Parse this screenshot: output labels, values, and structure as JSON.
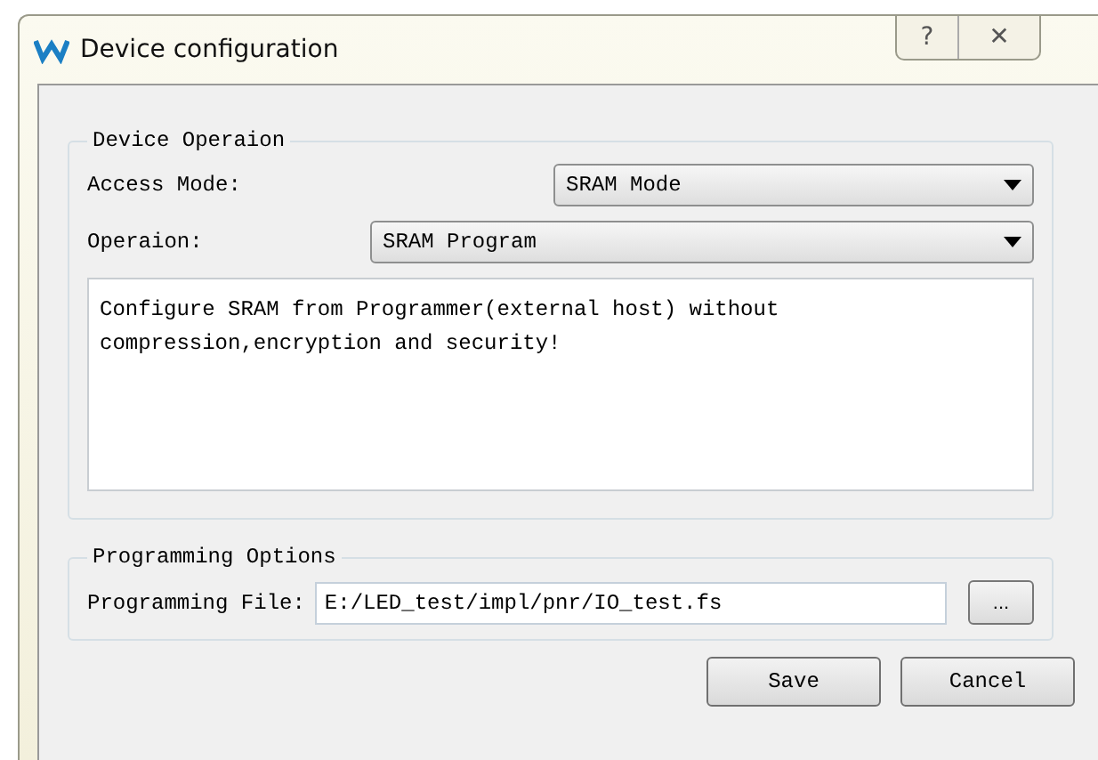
{
  "window": {
    "title": "Device configuration",
    "help": "?",
    "close": "✕"
  },
  "device_operation": {
    "title": "Device Operaion",
    "access_mode": {
      "label": "Access Mode:",
      "value": "SRAM Mode"
    },
    "operation": {
      "label": "Operaion:",
      "value": "SRAM Program"
    },
    "description": "Configure SRAM from Programmer(external host) without\ncompression,encryption and security!"
  },
  "programming_options": {
    "title": "Programming Options",
    "file": {
      "label": "Programming File:",
      "value": "E:/LED_test/impl/pnr/IO_test.fs"
    },
    "browse": "..."
  },
  "buttons": [
    "Save",
    "Cancel"
  ]
}
